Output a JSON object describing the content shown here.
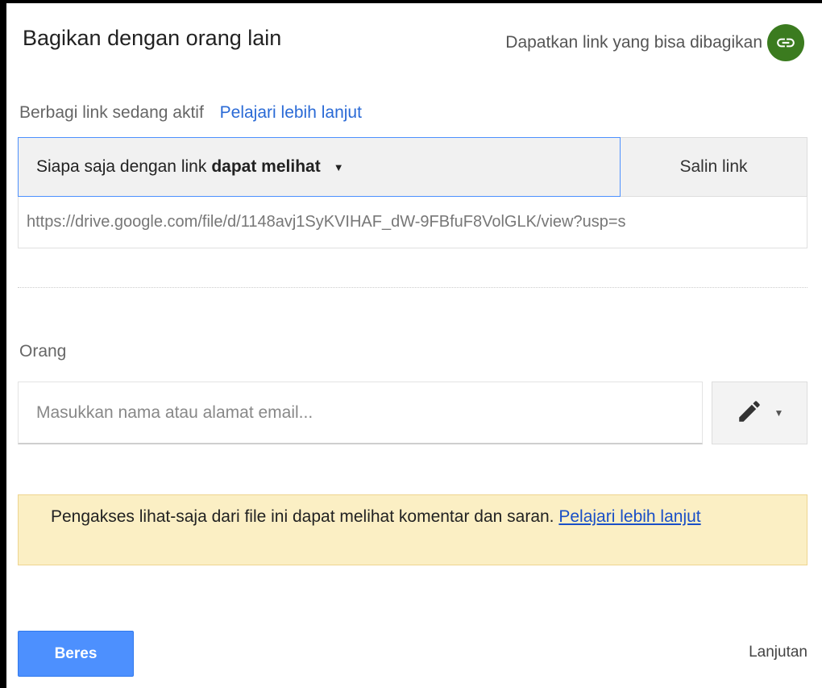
{
  "dialog": {
    "title": "Bagikan dengan orang lain",
    "get_link_label": "Dapatkan link yang bisa dibagikan",
    "link_icon": "link-icon"
  },
  "link_sharing": {
    "status": "Berbagi link sedang aktif",
    "learn_more": "Pelajari lebih lanjut",
    "access_prefix": "Siapa saja dengan link",
    "access_level": "dapat melihat",
    "copy_link": "Salin link",
    "url": "https://drive.google.com/file/d/1148avj1SyKVIHAF_dW-9FBfuF8VolGLK/view?usp=s"
  },
  "people": {
    "label": "Orang",
    "placeholder": "Masukkan nama atau alamat email...",
    "permission_icon": "pencil-icon"
  },
  "notice": {
    "text": "Pengakses lihat-saja dari file ini dapat melihat komentar dan saran. ",
    "learn_more": "Pelajari lebih lanjut"
  },
  "footer": {
    "done": "Beres",
    "advanced": "Lanjutan"
  },
  "colors": {
    "primary_blue": "#4d90fe",
    "link_blue": "#2a6ad6",
    "link_badge_green": "#3b7b1f",
    "notice_bg": "#fbefc4"
  }
}
